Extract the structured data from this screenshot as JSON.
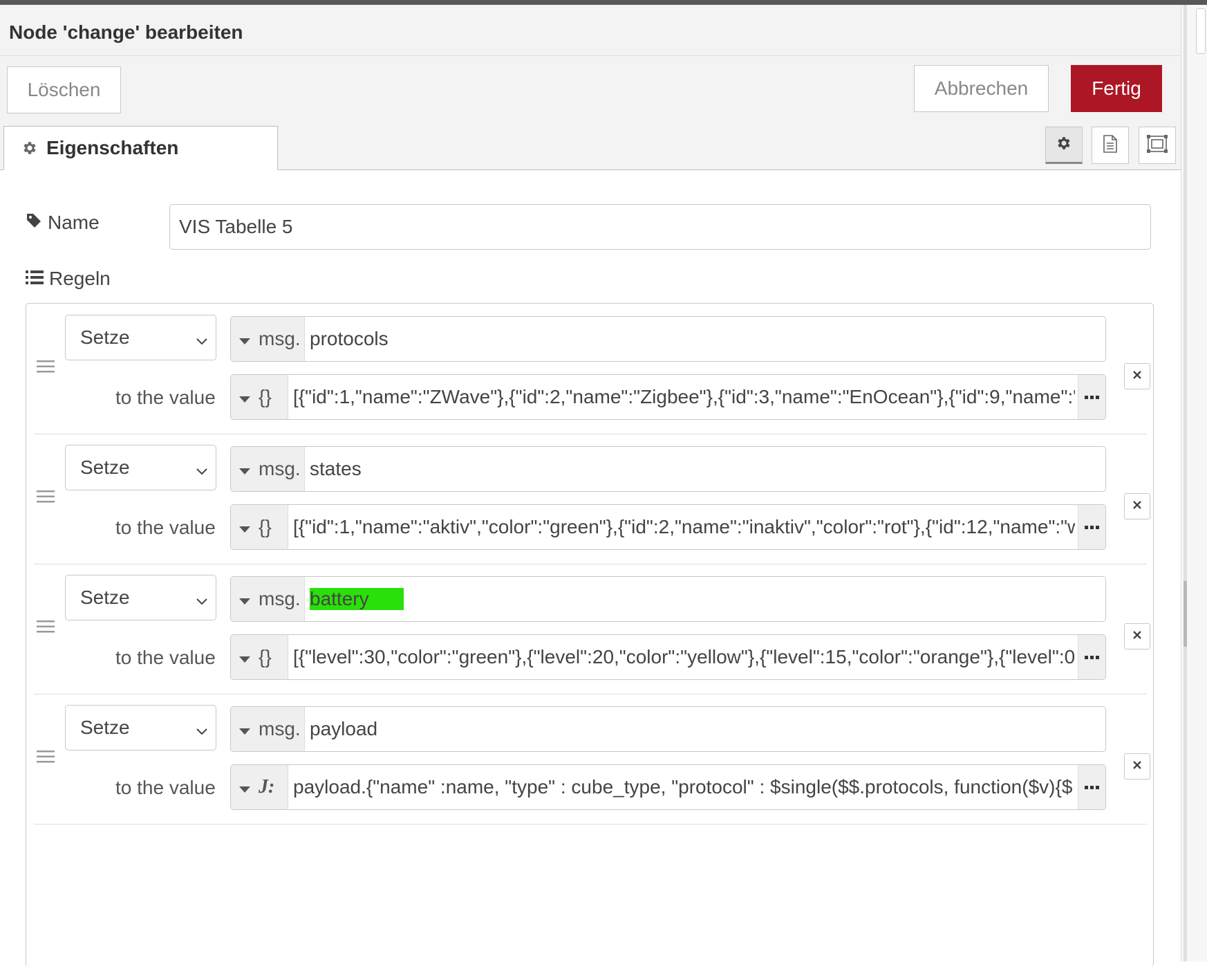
{
  "dialog": {
    "title": "Node 'change' bearbeiten",
    "delete_label": "Löschen",
    "cancel_label": "Abbrechen",
    "done_label": "Fertig",
    "accent_color": "#ad1625"
  },
  "tabs": {
    "properties_label": "Eigenschaften",
    "icons": [
      "gear-icon",
      "description-icon",
      "appearance-icon"
    ]
  },
  "form": {
    "name_label": "Name",
    "name_value": "VIS Tabelle 5",
    "rules_label": "Regeln"
  },
  "rules": [
    {
      "action": "Setze",
      "target_prefix": "msg.",
      "target": "protocols",
      "to_label": "to the value",
      "value_type_icon": "{}",
      "value": "[{\"id\":1,\"name\":\"ZWave\"},{\"id\":2,\"name\":\"Zigbee\"},{\"id\":3,\"name\":\"EnOcean\"},{\"id\":9,\"name\":\""
    },
    {
      "action": "Setze",
      "target_prefix": "msg.",
      "target": "states",
      "to_label": "to the value",
      "value_type_icon": "{}",
      "value": "[{\"id\":1,\"name\":\"aktiv\",\"color\":\"green\"},{\"id\":2,\"name\":\"inaktiv\",\"color\":\"rot\"},{\"id\":12,\"name\":\"w"
    },
    {
      "action": "Setze",
      "target_prefix": "msg.",
      "target": "battery",
      "target_highlight": "#2ae00a",
      "to_label": "to the value",
      "value_type_icon": "{}",
      "value": "[{\"level\":30,\"color\":\"green\"},{\"level\":20,\"color\":\"yellow\"},{\"level\":15,\"color\":\"orange\"},{\"level\":0,"
    },
    {
      "action": "Setze",
      "target_prefix": "msg.",
      "target": "payload",
      "to_label": "to the value",
      "value_type_icon": "J:",
      "value": "payload.{\"name\" :name,  \"type\" : cube_type,  \"protocol\" : $single($$.protocols, function($v){$"
    }
  ]
}
